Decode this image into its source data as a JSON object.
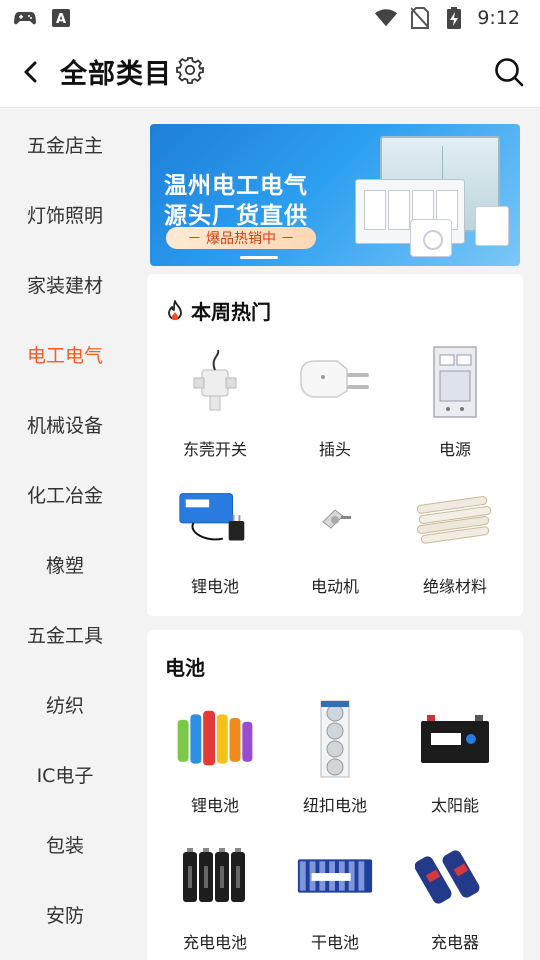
{
  "status_bar": {
    "time": "9:12",
    "icons": [
      "gamepad-icon",
      "keyboard-a-icon",
      "wifi-icon",
      "no-sim-icon",
      "battery-charging-icon"
    ]
  },
  "header": {
    "title": "全部类目",
    "back_icon": "back-chevron-icon",
    "settings_icon": "gear-icon",
    "search_icon": "search-icon"
  },
  "sidebar": {
    "active_index": 3,
    "accent_color": "#ff5a1f",
    "items": [
      {
        "label": "五金店主"
      },
      {
        "label": "灯饰照明"
      },
      {
        "label": "家装建材"
      },
      {
        "label": "电工电气"
      },
      {
        "label": "机械设备"
      },
      {
        "label": "化工冶金"
      },
      {
        "label": "橡塑"
      },
      {
        "label": "五金工具"
      },
      {
        "label": "纺织"
      },
      {
        "label": "IC电子"
      },
      {
        "label": "包装"
      },
      {
        "label": "安防"
      }
    ]
  },
  "banner": {
    "line1": "温州电工电气",
    "line2": "源头厂货直供",
    "pill": "－ 爆品热销中 －"
  },
  "hot_section": {
    "title": "本周热门",
    "icon": "flame-icon",
    "items": [
      {
        "label": "东莞开关",
        "icon": "valve-switch-icon"
      },
      {
        "label": "插头",
        "icon": "plug-icon"
      },
      {
        "label": "电源",
        "icon": "power-cabinet-icon"
      },
      {
        "label": "锂电池",
        "icon": "battery-pack-icon"
      },
      {
        "label": "电动机",
        "icon": "motor-icon"
      },
      {
        "label": "绝缘材料",
        "icon": "insulation-tube-icon"
      }
    ]
  },
  "battery_section": {
    "title": "电池",
    "items": [
      {
        "label": "锂电池",
        "icon": "colored-cells-icon"
      },
      {
        "label": "纽扣电池",
        "icon": "coin-cell-icon"
      },
      {
        "label": "太阳能",
        "icon": "solar-battery-icon"
      },
      {
        "label": "充电电池",
        "icon": "rechargeable-cells-icon"
      },
      {
        "label": "干电池",
        "icon": "dry-cell-pack-icon"
      },
      {
        "label": "充电器",
        "icon": "charger-cells-icon"
      }
    ]
  }
}
